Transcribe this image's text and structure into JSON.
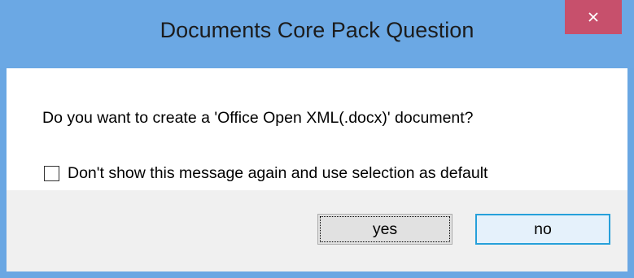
{
  "dialog": {
    "title": "Documents Core Pack Question",
    "close_icon": "close-icon",
    "message": "Do you want to create a 'Office Open XML(.docx)' document?",
    "checkbox": {
      "label": "Don't show this message again and use selection as default",
      "checked": false
    },
    "buttons": {
      "yes_label": "yes",
      "no_label": "no"
    }
  },
  "colors": {
    "titlebar": "#6ba8e4",
    "close_button": "#c7506c",
    "footer": "#f0f0f0",
    "default_button_border": "#26a0da"
  }
}
